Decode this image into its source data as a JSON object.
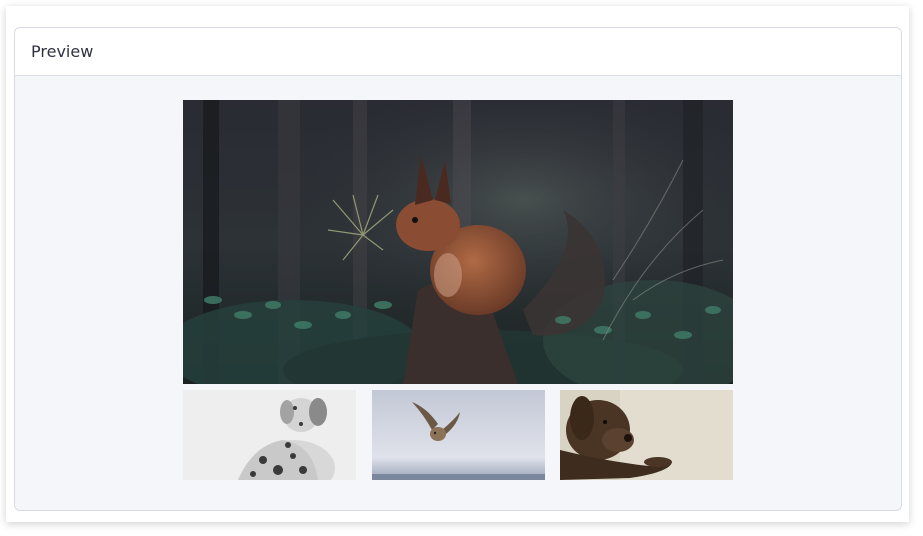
{
  "panel": {
    "title": "Preview"
  },
  "gallery": {
    "main_image": {
      "subject": "squirrel",
      "icon": "squirrel-photo"
    },
    "thumbnails": [
      {
        "subject": "dog",
        "icon": "dalmatian-puppy-photo"
      },
      {
        "subject": "owl",
        "icon": "owl-flying-photo"
      },
      {
        "subject": "dog",
        "icon": "chocolate-labrador-photo"
      }
    ]
  },
  "colors": {
    "panel_background": "#f5f6fa",
    "header_background": "#ffffff",
    "border": "#d9dbe2",
    "title_text": "#2f3340"
  }
}
